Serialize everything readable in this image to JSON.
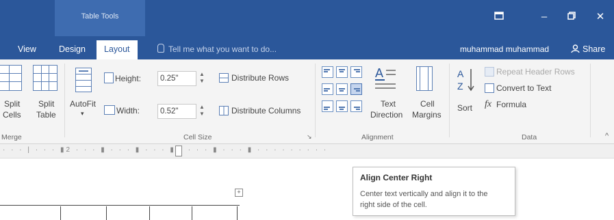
{
  "contextual_tab": {
    "label": "Table Tools"
  },
  "tabs": [
    {
      "label": "View"
    },
    {
      "label": "Design"
    },
    {
      "label": "Layout",
      "active": true
    }
  ],
  "tell_me": {
    "placeholder": "Tell me what you want to do..."
  },
  "user": {
    "name": "muhammad muhammad"
  },
  "share": {
    "label": "Share"
  },
  "window_controls": {
    "restore_icon": "ribbon-display-icon",
    "minimize": "–",
    "maximize_icon": "restore-icon",
    "close": "✕"
  },
  "ribbon": {
    "merge": {
      "group_label": "Merge",
      "split_cells": {
        "line1": "Split",
        "line2": "Cells"
      },
      "split_table": {
        "line1": "Split",
        "line2": "Table"
      }
    },
    "autofit": {
      "label": "AutoFit",
      "arrow": "▾"
    },
    "cell_size": {
      "group_label": "Cell Size",
      "height": {
        "label": "Height:",
        "value": "0.25\""
      },
      "width": {
        "label": "Width:",
        "value": "0.52\""
      },
      "distribute_rows": "Distribute Rows",
      "distribute_columns": "Distribute Columns",
      "launcher": "↘"
    },
    "alignment": {
      "group_label": "Alignment",
      "text_direction": {
        "line1": "Text",
        "line2": "Direction"
      },
      "cell_margins": {
        "line1": "Cell",
        "line2": "Margins"
      }
    },
    "data": {
      "group_label": "Data",
      "sort": "Sort",
      "repeat_header_rows": "Repeat Header Rows",
      "convert_to_text": "Convert to Text",
      "formula": "Formula",
      "collapse": "^"
    }
  },
  "tooltip": {
    "title": "Align Center Right",
    "description": "Center text vertically and align it to the right side of the cell."
  },
  "colors": {
    "accent": "#2b579a",
    "ribbon_bg": "#f4f4f4"
  }
}
